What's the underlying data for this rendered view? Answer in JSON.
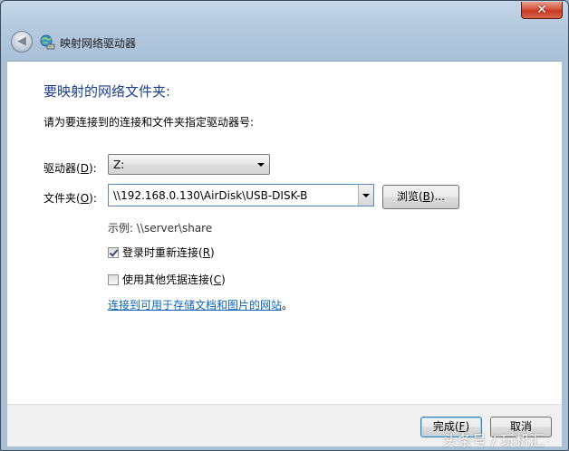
{
  "window": {
    "title": "映射网络驱动器",
    "close_glyph": "✕",
    "back_glyph": "◀"
  },
  "content": {
    "heading": "要映射的网络文件夹:",
    "instruction": "请为要连接到的连接和文件夹指定驱动器号:"
  },
  "drive": {
    "label_pre": "驱动器(",
    "label_key": "D",
    "label_post": "):",
    "value": "Z:"
  },
  "folder": {
    "label_pre": "文件夹(",
    "label_key": "O",
    "label_post": "):",
    "value": "\\\\192.168.0.130\\AirDisk\\USB-DISK-B"
  },
  "browse_button": {
    "label_pre": "浏览(",
    "label_key": "B",
    "label_post": ")..."
  },
  "example_text": "示例: \\\\server\\share",
  "reconnect": {
    "checked": true,
    "label_pre": "登录时重新连接(",
    "label_key": "R",
    "label_post": ")"
  },
  "other_credentials": {
    "checked": false,
    "label_pre": "使用其他凭据连接(",
    "label_key": "C",
    "label_post": ")"
  },
  "link": {
    "text": "连接到可用于存储文档和图片的网站",
    "suffix": "。"
  },
  "footer": {
    "finish": {
      "label_pre": "完成(",
      "label_key": "F",
      "label_post": ")"
    },
    "cancel_label": "取消"
  },
  "watermark": "头条号 / 玩机汇",
  "colors": {
    "heading": "#1e3f8b",
    "link": "#0e64b3",
    "close_button": "#c43a22"
  }
}
